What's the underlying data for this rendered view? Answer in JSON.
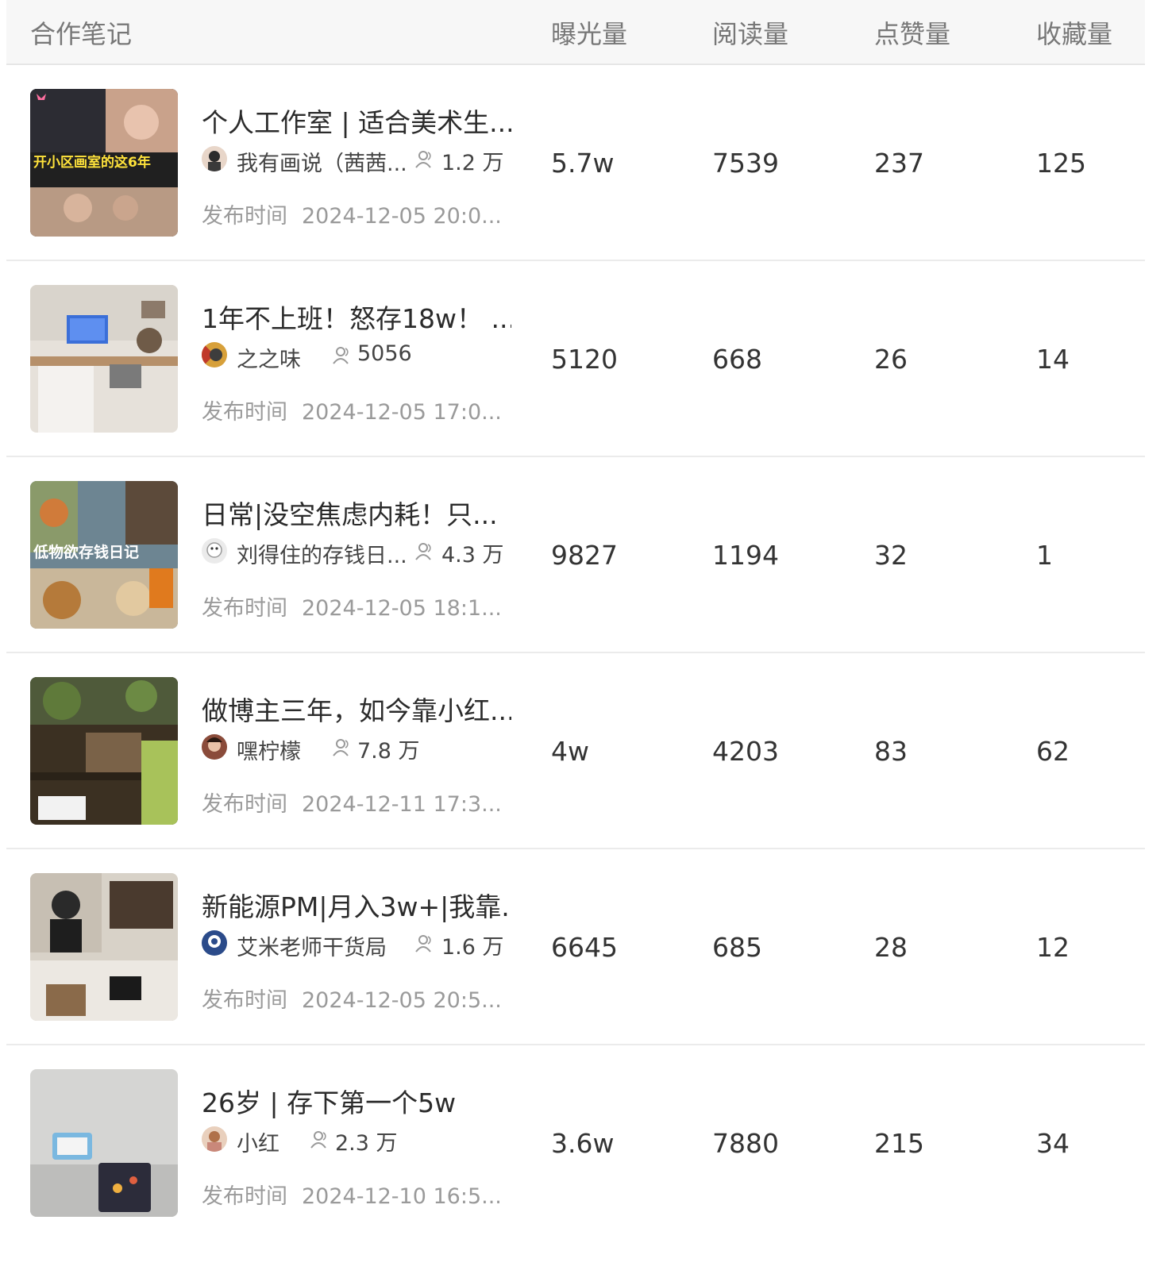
{
  "columns": {
    "note": "合作笔记",
    "impressions": "曝光量",
    "reads": "阅读量",
    "likes": "点赞量",
    "favorites": "收藏量"
  },
  "rows": [
    {
      "title": "个人工作室 | 适合美术生...",
      "author": "我有画说（茜茜...",
      "fans": "1.2 万",
      "pub_label": "发布时间",
      "pub_time": "2024-12-05 20:0...",
      "impressions": "5.7w",
      "reads": "7539",
      "likes": "237",
      "favorites": "125",
      "thumb_caption": "开小区画室的这6年"
    },
    {
      "title": "1年不上班！怒存18w！ ...",
      "author": "之之味",
      "fans": "5056",
      "pub_label": "发布时间",
      "pub_time": "2024-12-05 17:0...",
      "impressions": "5120",
      "reads": "668",
      "likes": "26",
      "favorites": "14"
    },
    {
      "title": "日常|没空焦虑内耗！只...",
      "author": "刘得住的存钱日...",
      "fans": "4.3 万",
      "pub_label": "发布时间",
      "pub_time": "2024-12-05 18:1...",
      "impressions": "9827",
      "reads": "1194",
      "likes": "32",
      "favorites": "1",
      "thumb_caption": "低物欲存钱日记"
    },
    {
      "title": "做博主三年，如今靠小红...",
      "author": "嘿柠檬",
      "fans": "7.8 万",
      "pub_label": "发布时间",
      "pub_time": "2024-12-11 17:3...",
      "impressions": "4w",
      "reads": "4203",
      "likes": "83",
      "favorites": "62"
    },
    {
      "title": "新能源PM|月入3w+|我靠...",
      "author": "艾米老师干货局",
      "fans": "1.6 万",
      "pub_label": "发布时间",
      "pub_time": "2024-12-05 20:5...",
      "impressions": "6645",
      "reads": "685",
      "likes": "28",
      "favorites": "12"
    },
    {
      "title": "26岁 | 存下第一个5w",
      "author": "小红",
      "fans": "2.3 万",
      "pub_label": "发布时间",
      "pub_time": "2024-12-10 16:5...",
      "impressions": "3.6w",
      "reads": "7880",
      "likes": "215",
      "favorites": "34"
    }
  ]
}
